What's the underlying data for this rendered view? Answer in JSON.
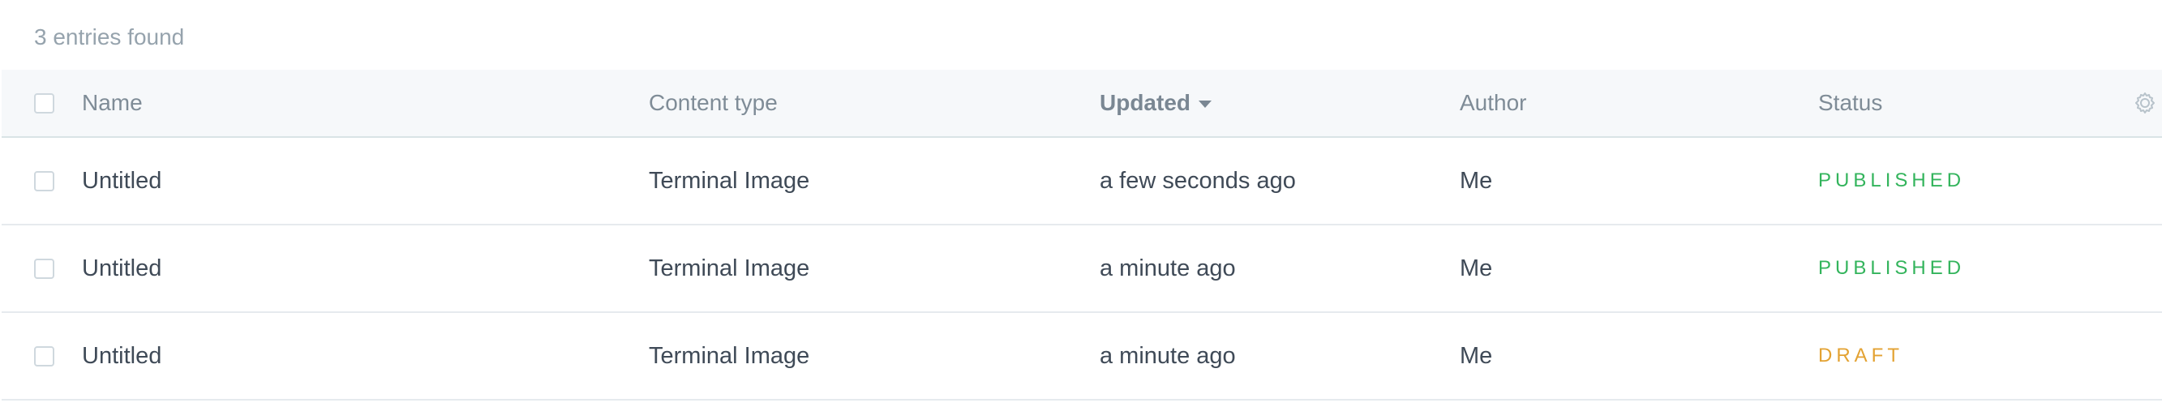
{
  "summary": {
    "text": "3 entries found"
  },
  "table": {
    "columns": {
      "name": "Name",
      "content_type": "Content type",
      "updated": "Updated",
      "author": "Author",
      "status": "Status"
    },
    "settings_icon": "gear-icon",
    "rows": [
      {
        "name": "Untitled",
        "content_type": "Terminal Image",
        "updated": "a few seconds ago",
        "author": "Me",
        "status": "PUBLISHED",
        "status_color": "#33b45c"
      },
      {
        "name": "Untitled",
        "content_type": "Terminal Image",
        "updated": "a minute ago",
        "author": "Me",
        "status": "PUBLISHED",
        "status_color": "#33b45c"
      },
      {
        "name": "Untitled",
        "content_type": "Terminal Image",
        "updated": "a minute ago",
        "author": "Me",
        "status": "DRAFT",
        "status_color": "#e3a232"
      }
    ]
  },
  "colors": {
    "summary_text": "#96a3ad",
    "header_background": "#f6f8fa",
    "body_text": "#3f4a57",
    "muted_text": "#7f8c97",
    "row_divider": "#e6eaee"
  }
}
